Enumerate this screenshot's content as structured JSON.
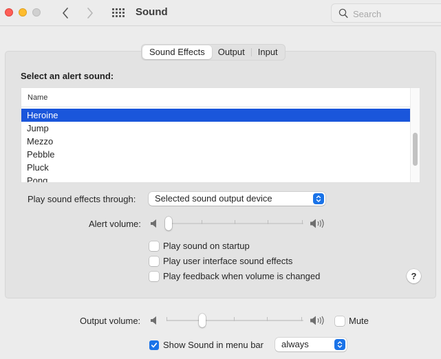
{
  "window": {
    "title": "Sound",
    "search_placeholder": "Search",
    "icons": {
      "close": "close-button",
      "minimize": "minimize-button",
      "zoom": "zoom-button",
      "back": "chevron-left-icon",
      "forward": "chevron-right-icon",
      "show_all": "grid-icon",
      "search": "magnifier-icon"
    }
  },
  "tabs": [
    {
      "label": "Sound Effects",
      "active": true
    },
    {
      "label": "Output",
      "active": false
    },
    {
      "label": "Input",
      "active": false
    }
  ],
  "sound_effects": {
    "section_label": "Select an alert sound:",
    "table": {
      "column_header": "Name",
      "rows": [
        "Heroine",
        "Jump",
        "Mezzo",
        "Pebble",
        "Pluck",
        "Pong"
      ],
      "selected": "Heroine"
    },
    "play_through": {
      "label": "Play sound effects through:",
      "value": "Selected sound output device"
    },
    "alert_volume": {
      "label": "Alert volume:",
      "value_fraction": 0.0
    },
    "checkboxes": [
      {
        "label": "Play sound on startup",
        "checked": false
      },
      {
        "label": "Play user interface sound effects",
        "checked": false
      },
      {
        "label": "Play feedback when volume is changed",
        "checked": false
      }
    ],
    "help_label": "?"
  },
  "footer": {
    "output_volume": {
      "label": "Output volume:",
      "value_fraction": 0.25
    },
    "mute": {
      "label": "Mute",
      "checked": false
    },
    "show_in_menu_bar": {
      "label": "Show Sound in menu bar",
      "checked": true
    },
    "menu_bar_option": {
      "value": "always"
    }
  },
  "colors": {
    "accent": "#1a73e8",
    "selection": "#1a56db"
  }
}
